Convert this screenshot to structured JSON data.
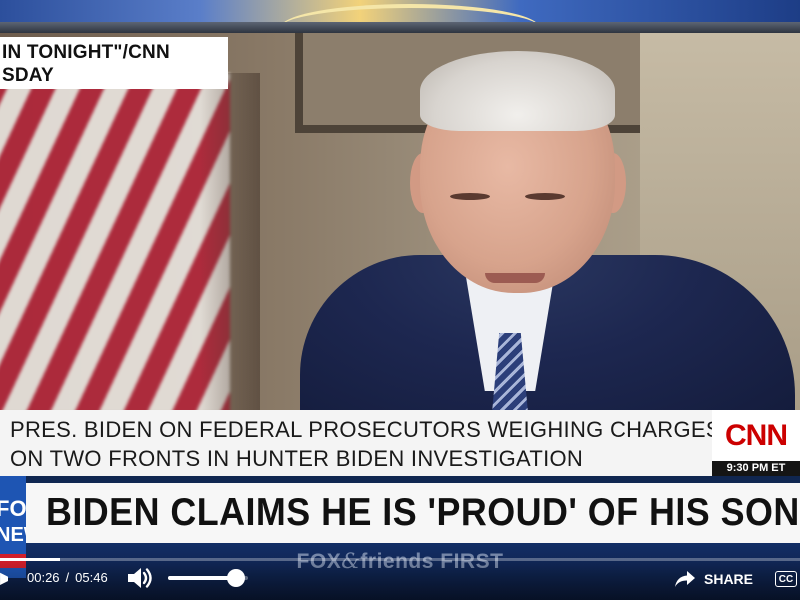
{
  "video": {
    "source_caption": {
      "line1": "IN TONIGHT\"/CNN",
      "line2": "SDAY"
    },
    "cnn_lower_third": {
      "line1": "PRES. BIDEN ON FEDERAL PROSECUTORS WEIGHING CHARGES",
      "line2": "ON TWO FRONTS IN HUNTER BIDEN INVESTIGATION",
      "logo": "CNN",
      "time": "9:30 PM ET",
      "brand_color": "#cc0000"
    },
    "fox_lower_third": {
      "headline": "BIDEN CLAIMS HE IS 'PROUD' OF HIS SON HUN",
      "logo_line1": "FOX",
      "logo_line2": "NEWS",
      "show_name_part1": "FOX",
      "show_name_amp": "&",
      "show_name_part2": "friends FIRST",
      "brand_color": "#1e55b3"
    }
  },
  "player": {
    "current_time": "00:26",
    "time_separator": "/",
    "duration": "05:46",
    "progress_fraction": 0.075,
    "volume_icon": "speaker-icon",
    "volume_fraction": 0.85,
    "share_label": "SHARE",
    "share_icon": "share-arrow-icon",
    "cc_label": "CC"
  }
}
